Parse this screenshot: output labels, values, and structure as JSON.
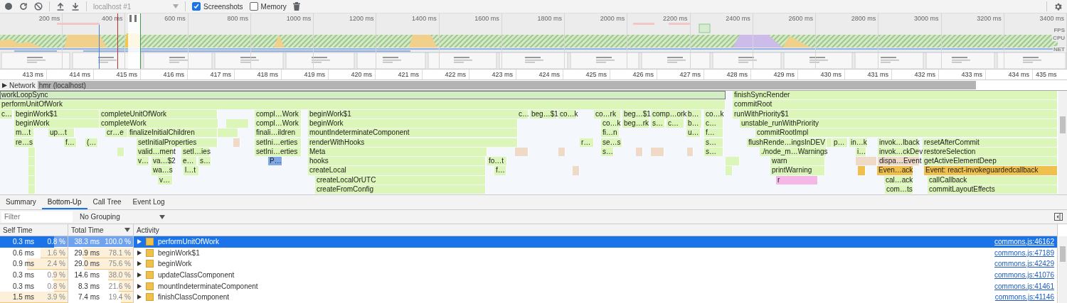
{
  "toolbar": {
    "profile": "localhost #1",
    "checkboxes": [
      {
        "label": "Screenshots",
        "checked": true
      },
      {
        "label": "Memory",
        "checked": false
      }
    ]
  },
  "overview": {
    "ticks": [
      "200 ms",
      "400 ms",
      "600 ms",
      "800 ms",
      "1000 ms",
      "1200 ms",
      "1400 ms",
      "1600 ms",
      "1800 ms",
      "2000 ms",
      "2200 ms",
      "2400 ms",
      "2600 ms",
      "2800 ms",
      "3000 ms",
      "3200 ms",
      "3400 ms"
    ],
    "lanes": [
      "FPS",
      "CPU",
      "NET"
    ]
  },
  "timeline": {
    "ticks": [
      "413 ms",
      "414 ms",
      "415 ms",
      "416 ms",
      "417 ms",
      "418 ms",
      "419 ms",
      "420 ms",
      "421 ms",
      "422 ms",
      "423 ms",
      "424 ms",
      "425 ms",
      "426 ms",
      "427 ms",
      "428 ms",
      "429 ms",
      "430 ms",
      "431 ms",
      "432 ms",
      "433 ms",
      "434 ms",
      "435 ms"
    ]
  },
  "network_track": {
    "label": "Network",
    "request": "hmr (localhost)",
    "expanded": false
  },
  "flame_chart": {
    "rows": [
      [
        {
          "label": "workLoopSync",
          "color": "#d2ecc4",
          "selected": true
        },
        {
          "label": "finishSyncRender",
          "color": "#dcf5b8",
          "selected": false
        }
      ],
      [
        {
          "label": "performUnitOfWork",
          "color": "#dcf5b8",
          "selected": false
        },
        {
          "label": "commitRoot",
          "color": "#dcf5b8",
          "selected": false
        }
      ],
      [
        {
          "label": "c…",
          "color": "#dcf5b8",
          "selected": false
        },
        {
          "label": "beginWork$1",
          "color": "#dcf5b8",
          "selected": false
        },
        {
          "label": "completeUnitOfWork",
          "color": "#dcf5b8",
          "selected": false
        },
        {
          "label": "compl…Work",
          "color": "#dcf5b8",
          "selected": false
        },
        {
          "label": "beginWork$1",
          "color": "#dcf5b8",
          "selected": false
        },
        {
          "label": "c…",
          "color": "#dcf5b8",
          "selected": false
        },
        {
          "label": "beg…$1",
          "color": "#dcf5b8",
          "selected": false
        },
        {
          "label": "co…k",
          "color": "#dcf5b8",
          "selected": false
        },
        {
          "label": "co…rk",
          "color": "#dcf5b8",
          "selected": false
        },
        {
          "label": "beg…$1",
          "color": "#dcf5b8",
          "selected": false
        },
        {
          "label": "comp…ork",
          "color": "#dcf5b8",
          "selected": false
        },
        {
          "label": "b…",
          "color": "#dcf5b8",
          "selected": false
        },
        {
          "label": "co…k",
          "color": "#dcf5b8",
          "selected": false
        },
        {
          "label": "runWithPriority$1",
          "color": "#dcf5b8",
          "selected": false
        }
      ],
      [
        {
          "label": "beginWork",
          "color": "#dcf5b8",
          "selected": false
        },
        {
          "label": "completeWork",
          "color": "#dcf5b8",
          "selected": false
        },
        {
          "label": "compl…Work",
          "color": "#dcf5b8",
          "selected": false
        },
        {
          "label": "beginWork",
          "color": "#dcf5b8",
          "selected": false
        },
        {
          "label": "co…k",
          "color": "#dcf5b8",
          "selected": false
        },
        {
          "label": "beg…rk",
          "color": "#dcf5b8",
          "selected": false
        },
        {
          "label": "s…",
          "color": "#dcf5b8",
          "selected": false
        },
        {
          "label": "c…",
          "color": "#dcf5b8",
          "selected": false
        },
        {
          "label": "b…",
          "color": "#dcf5b8",
          "selected": false
        },
        {
          "label": "c…",
          "color": "#dcf5b8",
          "selected": false
        },
        {
          "label": "unstable_runWithPriority",
          "color": "#dcf5b8",
          "selected": false
        }
      ],
      [
        {
          "label": "m…t",
          "color": "#dcf5b8",
          "selected": false
        },
        {
          "label": "up…t",
          "color": "#dcf5b8",
          "selected": false
        },
        {
          "label": "cr…e",
          "color": "#dcf5b8",
          "selected": false
        },
        {
          "label": "finalizeInitialChildren",
          "color": "#dcf5b8",
          "selected": false
        },
        {
          "label": "finali…ildren",
          "color": "#dcf5b8",
          "selected": false
        },
        {
          "label": "mountIndeterminateComponent",
          "color": "#dcf5b8",
          "selected": false
        },
        {
          "label": "fi…n",
          "color": "#dcf5b8",
          "selected": false
        },
        {
          "label": "u…",
          "color": "#dcf5b8",
          "selected": false
        },
        {
          "label": "f…",
          "color": "#dcf5b8",
          "selected": false
        },
        {
          "label": "commitRootImpl",
          "color": "#dcf5b8",
          "selected": false
        }
      ],
      [
        {
          "label": "re…s",
          "color": "#dcf5b8",
          "selected": false
        },
        {
          "label": "f…",
          "color": "#dcf5b8",
          "selected": false
        },
        {
          "label": "(…",
          "color": "#dcf5b8",
          "selected": false
        },
        {
          "label": "setInitialProperties",
          "color": "#dcf5b8",
          "selected": false
        },
        {
          "label": "setIni…erties",
          "color": "#dcf5b8",
          "selected": false
        },
        {
          "label": "renderWithHooks",
          "color": "#dcf5b8",
          "selected": false
        },
        {
          "label": "r…",
          "color": "#dcf5b8",
          "selected": false
        },
        {
          "label": "se…s",
          "color": "#dcf5b8",
          "selected": false
        },
        {
          "label": "s…",
          "color": "#dcf5b8",
          "selected": false
        },
        {
          "label": "flushRende…ingsInDEV",
          "color": "#dcf5b8",
          "selected": false
        },
        {
          "label": "p…",
          "color": "#dcf5b8",
          "selected": false
        },
        {
          "label": "in…k",
          "color": "#dcf5b8",
          "selected": false
        },
        {
          "label": "invok…lback",
          "color": "#dcf5b8",
          "selected": false
        },
        {
          "label": "resetAfterCommit",
          "color": "#dcf5b8",
          "selected": false
        }
      ],
      [
        {
          "label": "valid…ment",
          "color": "#dcf5b8",
          "selected": false
        },
        {
          "label": "setI…ies",
          "color": "#dcf5b8",
          "selected": false
        },
        {
          "label": "setIni…erties",
          "color": "#dcf5b8",
          "selected": false
        },
        {
          "label": "Meta",
          "color": "#dcf5b8",
          "selected": false
        },
        {
          "label": "s…",
          "color": "#dcf5b8",
          "selected": false
        },
        {
          "label": "s…",
          "color": "#dcf5b8",
          "selected": false
        },
        {
          "label": "./node_m…Warnings",
          "color": "#dcf5b8",
          "selected": false
        },
        {
          "label": "i…",
          "color": "#dcf5b8",
          "selected": false
        },
        {
          "label": "invok…ckDev",
          "color": "#dcf5b8",
          "selected": false
        },
        {
          "label": "restoreSelection",
          "color": "#dcf5b8",
          "selected": false
        }
      ],
      [
        {
          "label": "v…",
          "color": "#dcf5b8",
          "selected": false
        },
        {
          "label": "va…$2",
          "color": "#dcf5b8",
          "selected": false
        },
        {
          "label": "e…",
          "color": "#dcf5b8",
          "selected": false
        },
        {
          "label": "s…",
          "color": "#dcf5b8",
          "selected": false
        },
        {
          "label": "P…",
          "color": "#7fa8e6",
          "selected": false
        },
        {
          "label": "hooks",
          "color": "#dcf5b8",
          "selected": false
        },
        {
          "label": "fo…t",
          "color": "#dcf5b8",
          "selected": false
        },
        {
          "label": "warn",
          "color": "#dcf5b8",
          "selected": false
        },
        {
          "label": "dispa…Event",
          "color": "#efd9c7",
          "selected": false
        },
        {
          "label": "getActiveElementDeep",
          "color": "#dcf5b8",
          "selected": false
        }
      ],
      [
        {
          "label": "wa…s",
          "color": "#dcf5b8",
          "selected": false
        },
        {
          "label": "l…t",
          "color": "#dcf5b8",
          "selected": false
        },
        {
          "label": "createLocal",
          "color": "#dcf5b8",
          "selected": false
        },
        {
          "label": "f…",
          "color": "#dcf5b8",
          "selected": false
        },
        {
          "label": "printWarning",
          "color": "#dcf5b8",
          "selected": false
        },
        {
          "label": "Even…ack",
          "color": "#f0c04c",
          "selected": false
        },
        {
          "label": "Event: react-invokeguardedcallback",
          "color": "#f0c04c",
          "selected": false
        }
      ],
      [
        {
          "label": "v…",
          "color": "#dcf5b8",
          "selected": false
        },
        {
          "label": "createLocalOrUTC",
          "color": "#dcf5b8",
          "selected": false
        },
        {
          "label": "r",
          "color": "#f4b8e6",
          "selected": false
        },
        {
          "label": "cal…ack",
          "color": "#dcf5b8",
          "selected": false
        },
        {
          "label": "callCallback",
          "color": "#dcf5b8",
          "selected": false
        }
      ],
      [
        {
          "label": "createFromConfig",
          "color": "#dcf5b8",
          "selected": false
        },
        {
          "label": "com…ts",
          "color": "#dcf5b8",
          "selected": false
        },
        {
          "label": "commitLayoutEffects",
          "color": "#dcf5b8",
          "selected": false
        }
      ]
    ]
  },
  "tabs": [
    {
      "label": "Summary",
      "selected": false
    },
    {
      "label": "Bottom-Up",
      "selected": true
    },
    {
      "label": "Call Tree",
      "selected": false
    },
    {
      "label": "Event Log",
      "selected": false
    }
  ],
  "filter": {
    "placeholder": "Filter"
  },
  "grouping": "No Grouping",
  "table": {
    "columns": [
      {
        "label": "Self Time",
        "sorted": false
      },
      {
        "label": "Total Time",
        "sorted": true
      },
      {
        "label": "Activity",
        "sorted": false
      }
    ],
    "rows": [
      {
        "self": {
          "time": "0.3 ms",
          "percent": "0.8 %",
          "level": 0.2
        },
        "total": {
          "time": "38.3 ms",
          "percent": "100.0 %",
          "level": 1
        },
        "activity": "performUnitOfWork",
        "source": "commons.js:46162",
        "selected": true,
        "expanded": false
      },
      {
        "self": {
          "time": "0.6 ms",
          "percent": "1.6 %",
          "level": 0.4
        },
        "total": {
          "time": "29.9 ms",
          "percent": "78.1 %",
          "level": 0.78
        },
        "activity": "beginWork$1",
        "source": "commons.js:47189",
        "selected": false,
        "expanded": false
      },
      {
        "self": {
          "time": "0.9 ms",
          "percent": "2.4 %",
          "level": 0.6
        },
        "total": {
          "time": "29.0 ms",
          "percent": "75.6 %",
          "level": 0.76
        },
        "activity": "beginWork",
        "source": "commons.js:42429",
        "selected": false,
        "expanded": false
      },
      {
        "self": {
          "time": "0.3 ms",
          "percent": "0.9 %",
          "level": 0.22
        },
        "total": {
          "time": "14.6 ms",
          "percent": "38.0 %",
          "level": 0.38
        },
        "activity": "updateClassComponent",
        "source": "commons.js:41076",
        "selected": false,
        "expanded": false
      },
      {
        "self": {
          "time": "0.3 ms",
          "percent": "0.8 %",
          "level": 0.2
        },
        "total": {
          "time": "8.3 ms",
          "percent": "21.6 %",
          "level": 0.22
        },
        "activity": "mountIndeterminateComponent",
        "source": "commons.js:41461",
        "selected": false,
        "expanded": false
      },
      {
        "self": {
          "time": "1.5 ms",
          "percent": "3.9 %",
          "level": 1
        },
        "total": {
          "time": "7.4 ms",
          "percent": "19.4 %",
          "level": 0.19
        },
        "activity": "finishClassComponent",
        "source": "commons.js:41146",
        "selected": false,
        "expanded": false
      }
    ]
  }
}
